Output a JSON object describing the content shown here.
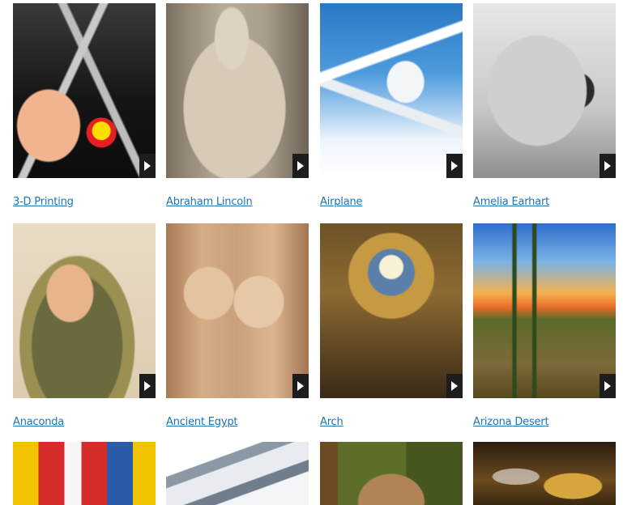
{
  "gallery": {
    "items": [
      {
        "title": "3-D Printing"
      },
      {
        "title": "Abraham Lincoln"
      },
      {
        "title": "Airplane"
      },
      {
        "title": "Amelia Earhart"
      },
      {
        "title": "Anaconda"
      },
      {
        "title": "Ancient Egypt"
      },
      {
        "title": "Arch"
      },
      {
        "title": "Arizona Desert"
      },
      {
        "title": ""
      },
      {
        "title": ""
      },
      {
        "title": ""
      },
      {
        "title": ""
      }
    ],
    "play_icon": "play-icon",
    "link_color": "#1e73b5",
    "play_button_color": "#1d1d1d"
  }
}
